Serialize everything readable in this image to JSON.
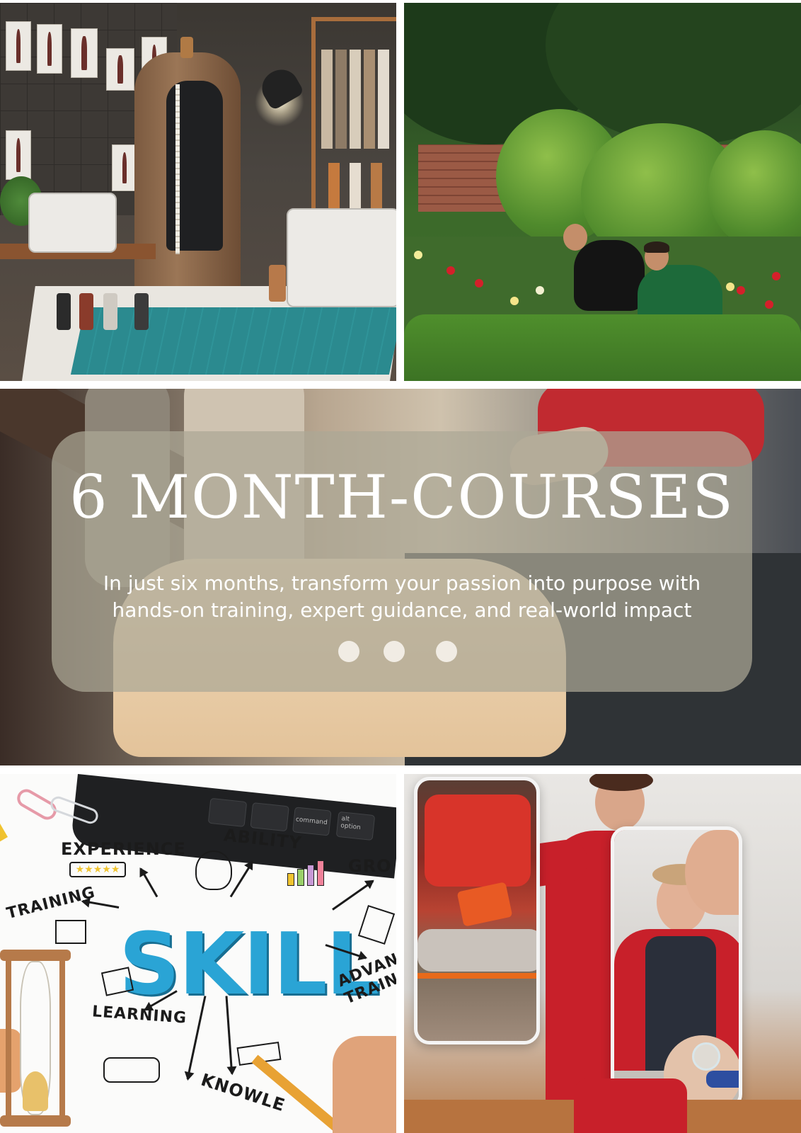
{
  "banner": {
    "title": "6 MONTH-COURSES",
    "subtitle_line1": "In just six months, transform your passion into purpose with",
    "subtitle_line2": "hands-on training, expert guidance, and real-world impact",
    "carousel_dots": 3
  },
  "skill_doodle": {
    "center_word": "SKILL",
    "words": {
      "experience": "EXPERIENCE",
      "ability": "ABILITY",
      "growth": "GRO",
      "training": "TRAINING",
      "advanced_training_line1": "ADVAN",
      "advanced_training_line2": "TRAIN",
      "learning": "LEARNING",
      "knowledge": "KNOWLE"
    },
    "keyboard_keys": {
      "command": "command",
      "option": "option",
      "alt": "alt"
    }
  },
  "colors": {
    "overlay": "#aca896",
    "title_text": "#ffffff",
    "skill_blue": "#2aa4d5",
    "medic_red": "#c8202a"
  },
  "images": {
    "sewing_studio": "sewing-studio-photo",
    "garden": "gardeners-roses-photo",
    "cpr": "cpr-training-photo",
    "skill": "skill-doodle-photo",
    "paramedics": "paramedics-photo"
  }
}
